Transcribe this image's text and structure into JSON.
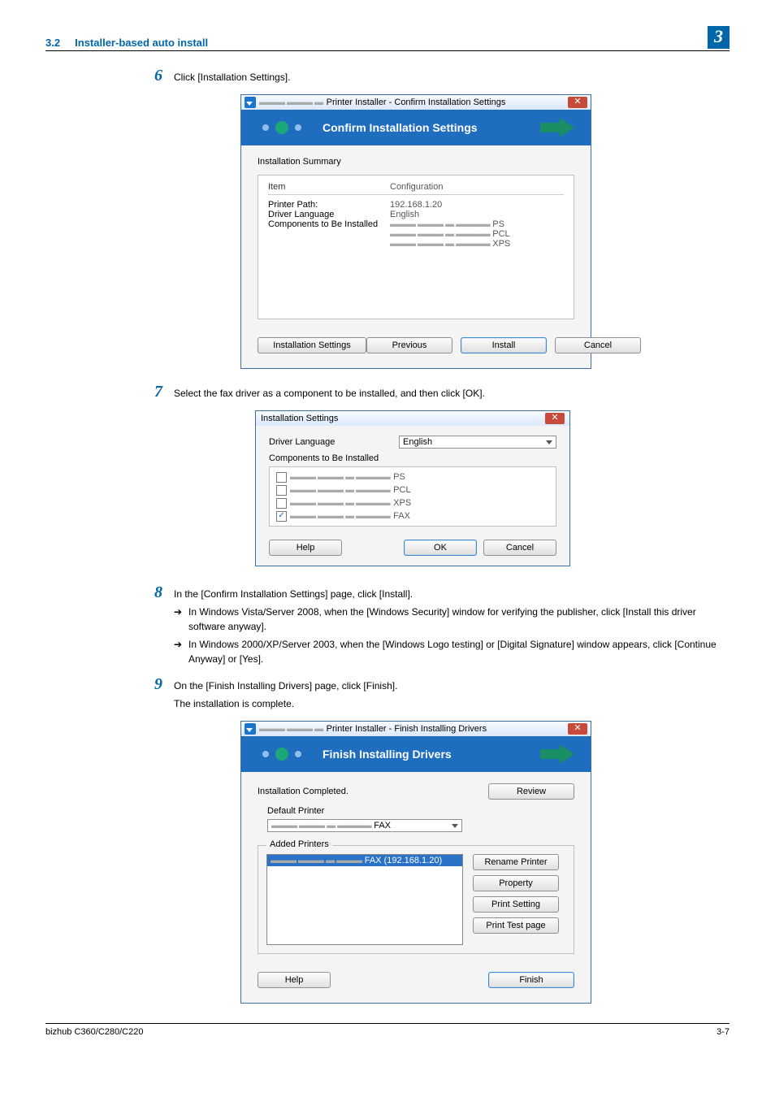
{
  "header": {
    "section_num": "3.2",
    "section_title": "Installer-based auto install",
    "chapter_badge": "3"
  },
  "steps": {
    "6": {
      "text": "Click [Installation Settings]."
    },
    "7": {
      "text": "Select the fax driver as a component to be installed, and then click [OK]."
    },
    "8": {
      "text": "In the [Confirm Installation Settings] page, click [Install].",
      "sub1": "In Windows Vista/Server 2008, when the [Windows Security] window for verifying the publisher, click [Install this driver software anyway].",
      "sub2": "In Windows 2000/XP/Server 2003, when the [Windows Logo testing] or [Digital Signature] window appears, click [Continue Anyway] or [Yes]."
    },
    "9": {
      "text": "On the [Finish Installing Drivers] page, click [Finish].",
      "text2": "The installation is complete."
    }
  },
  "dlg1": {
    "title_prefix": "Printer Installer - Confirm Installation Settings",
    "banner": "Confirm Installation Settings",
    "summary_label": "Installation Summary",
    "col_item": "Item",
    "col_config": "Configuration",
    "rows": {
      "printer_path_label": "Printer Path:",
      "printer_path_value": "192.168.1.20",
      "driver_lang_label": "Driver Language",
      "driver_lang_value": "English",
      "components_label": "Components to Be Installed",
      "comp1": "PS",
      "comp2": "PCL",
      "comp3": "XPS"
    },
    "btn_install_settings": "Installation Settings",
    "btn_previous": "Previous",
    "btn_install": "Install",
    "btn_cancel": "Cancel"
  },
  "dlg2": {
    "title": "Installation Settings",
    "driver_lang_label": "Driver Language",
    "driver_lang_value": "English",
    "components_label": "Components to Be Installed",
    "items": {
      "ps": "PS",
      "pcl": "PCL",
      "xps": "XPS",
      "fax": "FAX"
    },
    "btn_help": "Help",
    "btn_ok": "OK",
    "btn_cancel": "Cancel"
  },
  "dlg3": {
    "title_prefix": "Printer Installer - Finish Installing Drivers",
    "banner": "Finish Installing Drivers",
    "installation_completed": "Installation Completed.",
    "default_printer_label": "Default Printer",
    "default_printer_value": "FAX",
    "added_printers_label": "Added Printers",
    "added_item": "FAX (192.168.1.20)",
    "btn_review": "Review",
    "btn_rename": "Rename Printer",
    "btn_property": "Property",
    "btn_print_setting": "Print Setting",
    "btn_print_test": "Print Test page",
    "btn_help": "Help",
    "btn_finish": "Finish"
  },
  "footer": {
    "left": "bizhub C360/C280/C220",
    "right": "3-7"
  }
}
